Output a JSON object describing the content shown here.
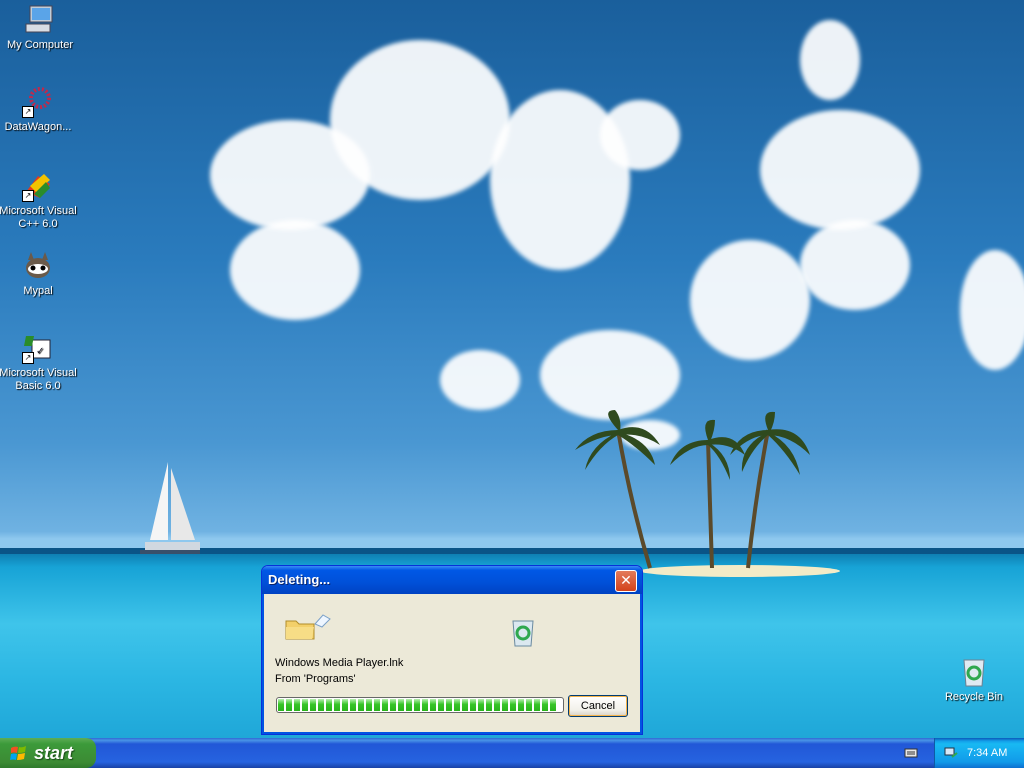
{
  "desktop": {
    "icons": [
      {
        "label": "My Computer",
        "icon": "my-computer-icon",
        "shortcut": false
      },
      {
        "label": "DataWagon...",
        "icon": "datawagon-icon",
        "shortcut": true
      },
      {
        "label": "Microsoft Visual C++ 6.0",
        "icon": "visual-cpp-icon",
        "shortcut": true
      },
      {
        "label": "Mypal",
        "icon": "mypal-icon",
        "shortcut": false
      },
      {
        "label": "Microsoft Visual Basic 6.0",
        "icon": "visual-basic-icon",
        "shortcut": true
      },
      {
        "label": "Recycle Bin",
        "icon": "recycle-bin-icon",
        "shortcut": false
      }
    ]
  },
  "dialog": {
    "title": "Deleting...",
    "file_name": "Windows Media Player.lnk",
    "from_line": "From 'Programs'",
    "progress_fraction": 1.0,
    "cancel_label": "Cancel"
  },
  "taskbar": {
    "start_label": "start",
    "clock": "7:34 AM"
  },
  "colors": {
    "taskbar_blue": "#2663e0",
    "start_green": "#3c9a3a",
    "title_blue": "#0050d8",
    "close_red": "#d3421b",
    "progress_green": "#37c427"
  }
}
